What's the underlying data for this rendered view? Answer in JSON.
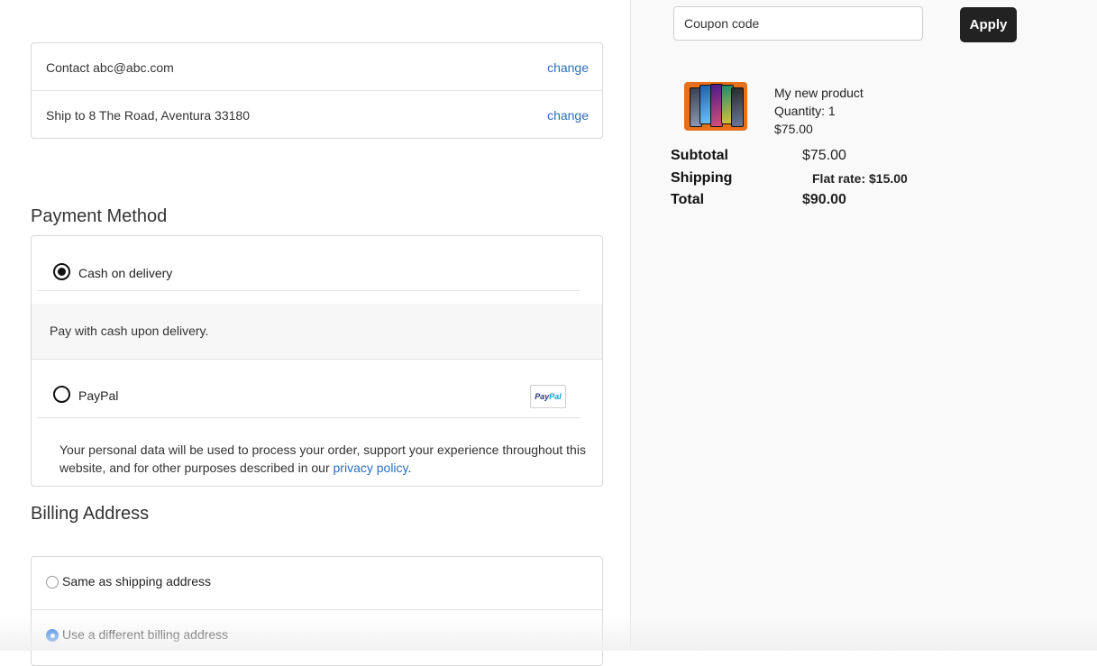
{
  "contact": {
    "contact_text": "Contact abc@abc.com",
    "contact_change": "change",
    "ship_text": "Ship to 8 The Road, Aventura 33180",
    "ship_change": "change"
  },
  "payment": {
    "title": "Payment Method",
    "options": [
      {
        "label": "Cash on delivery",
        "selected": true,
        "description": "Pay with cash upon delivery."
      },
      {
        "label": "PayPal",
        "selected": false,
        "logo_text_a": "Pay",
        "logo_text_b": "Pal"
      }
    ],
    "privacy_text": "Your personal data will be used to process your order, support your experience throughout this website, and for other purposes described in our ",
    "privacy_link": "privacy policy",
    "privacy_end": "."
  },
  "billing": {
    "title": "Billing Address",
    "options": [
      {
        "label": "Same as shipping address",
        "selected": false
      },
      {
        "label": "Use a different billing address",
        "selected": true
      }
    ]
  },
  "summary": {
    "coupon_placeholder": "Coupon code",
    "apply_label": "Apply",
    "product": {
      "name": "My new product",
      "quantity": "Quantity: 1",
      "price": "$75.00"
    },
    "subtotal_label": "Subtotal",
    "subtotal_value": "$75.00",
    "shipping_label": "Shipping",
    "shipping_value": "Flat rate: $15.00",
    "total_label": "Total",
    "total_value": "$90.00"
  },
  "colors": {
    "link": "#2a6ebb",
    "button": "#222222",
    "radio_checked": "#1a73e8"
  }
}
